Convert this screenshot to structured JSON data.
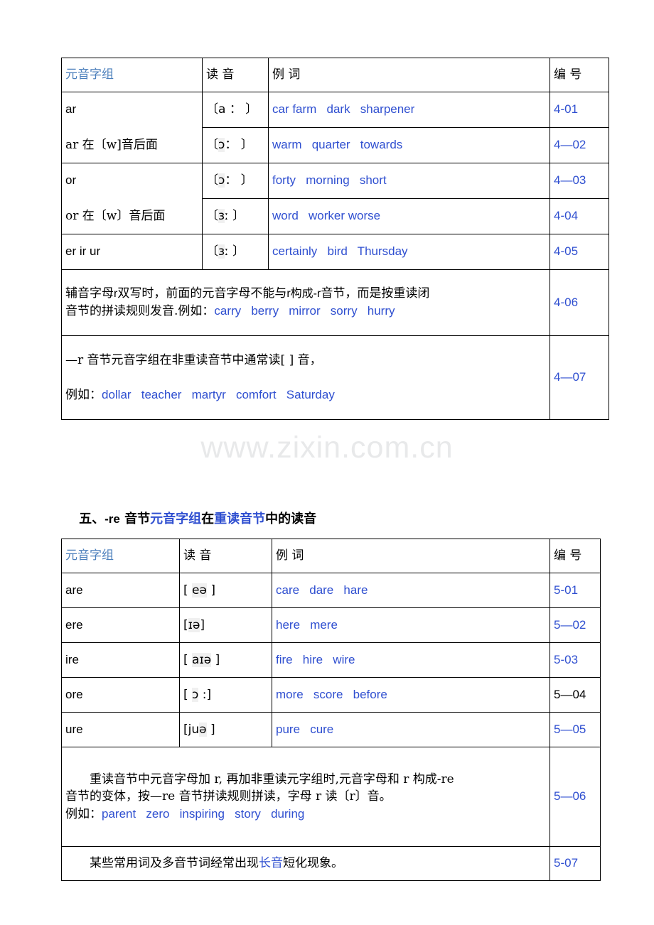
{
  "document": {
    "watermark": "www.zixin.com.cn",
    "colors": {
      "link_blue": "#2f4fd0",
      "header_blue": "#4a7ebb",
      "watermark_gray": "#e8e9ea",
      "border_black": "#000000"
    }
  },
  "table1": {
    "headers": {
      "col1": "元音字组",
      "col2": "读 音",
      "col3": "例 词",
      "col4": "编 号"
    },
    "rows": [
      {
        "letters": "ar",
        "phonetic_open": "〔",
        "phonetic_body": "a",
        "phonetic_tail": " ： ",
        "phonetic_close": "〕",
        "phonetic_full": "〔a ： 〕",
        "words": "car farm   dark   sharpener",
        "code": "4-01",
        "code_color": "#2f4fd0"
      },
      {
        "letters": "ar 在〔w]音后面",
        "phonetic_full": "〔ɔ： 〕",
        "words": "warm   quarter   towards",
        "code": "4—02",
        "code_color": "#2f4fd0"
      },
      {
        "letters": "or",
        "phonetic_full": "〔ɔ： 〕",
        "words": "forty   morning   short",
        "code": "4—03",
        "code_color": "#2f4fd0"
      },
      {
        "letters": "or 在〔w〕音后面",
        "phonetic_full": "〔ɜː 〕",
        "words": "word   worker worse",
        "code": "4-04",
        "code_color": "#2f4fd0"
      },
      {
        "letters": "er ir ur",
        "phonetic_full": "〔ɜː 〕",
        "words": "certainly   bird   Thursday",
        "code": "4-05",
        "code_color": "#2f4fd0"
      }
    ],
    "note1": {
      "line1_part1": "辅音字母",
      "line1_en1": "r",
      "line1_part2": "双写时，前面的元音字母不能与",
      "line1_en2": "r",
      "line1_part3": "构成-r",
      "line1_part4": "音节，而是按重读闭",
      "line2_part1": "音节的拼读规则发音.例如：",
      "line2_words": "carry   berry   mirror   sorry   hurry",
      "code": "4-06",
      "code_color": "#2f4fd0"
    },
    "note2": {
      "line1": "—r 音节元音字组在非重读音节中通常读[ ] 音，",
      "line2_prefix": "例如：",
      "line2_words": "dollar   teacher   martyr   comfort   Saturday",
      "code": "4—07",
      "code_color": "#2f4fd0"
    }
  },
  "section5": {
    "heading_number": "五、",
    "heading_re": "-re",
    "heading_p1": " 音节",
    "heading_blue1": "元音字组",
    "heading_p2": "在",
    "heading_blue2": "重读音节",
    "heading_p3": "中的读音"
  },
  "table2": {
    "headers": {
      "col1": "元音字组",
      "col2": "读 音",
      "col3": "例 词",
      "col4": "编 号"
    },
    "rows": [
      {
        "letters": "are",
        "phonetic_full": "[ eə ]",
        "words": "care   dare   hare",
        "code": "5-01",
        "code_color": "#2f4fd0"
      },
      {
        "letters": "ere",
        "phonetic_full": "[ɪə]",
        "words": "here   mere",
        "code": "5—02",
        "code_color": "#2f4fd0"
      },
      {
        "letters": "ire",
        "phonetic_full": "[ aɪə ]",
        "words": "fire   hire   wire",
        "code": "5-03",
        "code_color": "#2f4fd0"
      },
      {
        "letters": "ore",
        "phonetic_full": "[ ɔ :]",
        "words": "more   score   before",
        "code": "5—04",
        "code_color": "#000000"
      },
      {
        "letters": "ure",
        "phonetic_full": "[juə ]",
        "words": "pure   cure",
        "code": "5—05",
        "code_color": "#2f4fd0"
      }
    ],
    "note1": {
      "line1": "重读音节中元音字母加 r, 再加非重读元字组时,元音字母和 r 构成-re",
      "line2": "音节的变体，按—re 音节拼读规则拼读，字母 r 读〔r〕音。",
      "line3_prefix": "例如：",
      "line3_words": "parent   zero   inspiring   story   during",
      "code": "5—06",
      "code_color": "#2f4fd0"
    },
    "note2": {
      "part1": "某些常用词及多音节词经常出现",
      "blue": "长音",
      "part2": "短化现象。",
      "code": "5-07",
      "code_color": "#2f4fd0"
    }
  }
}
